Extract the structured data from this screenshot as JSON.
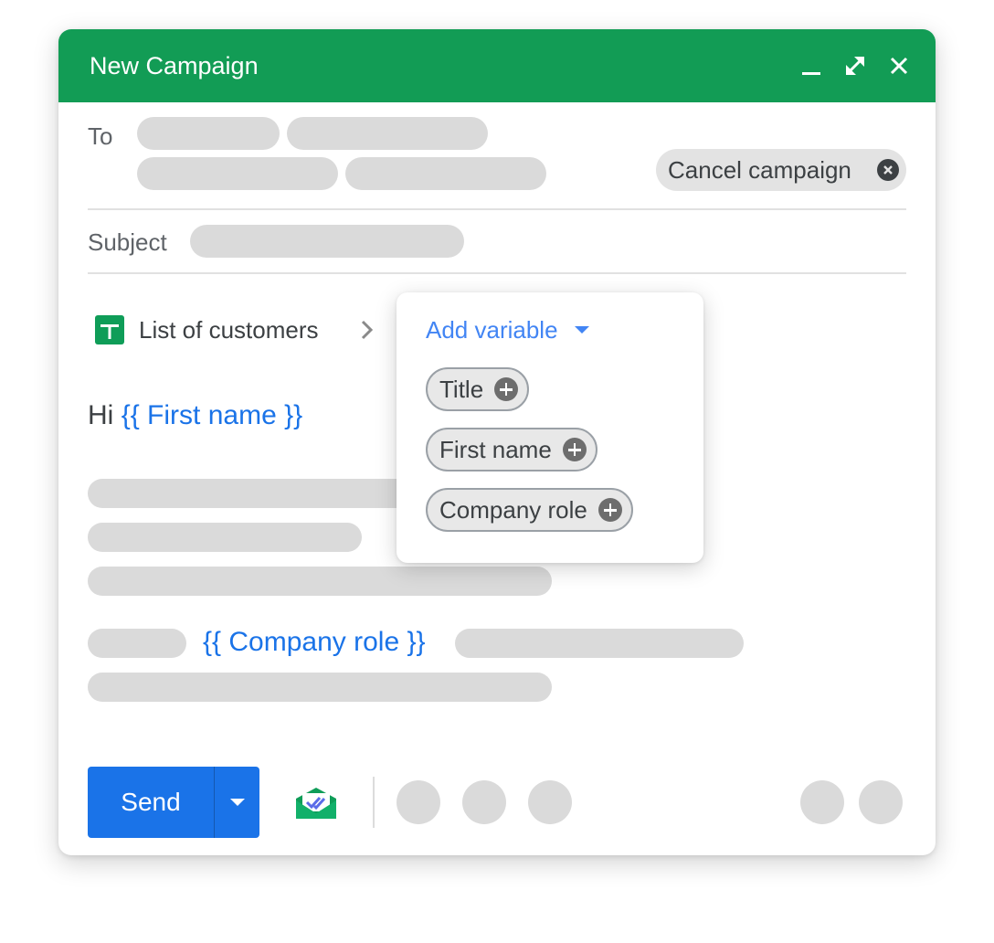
{
  "window": {
    "title": "New Campaign",
    "header_color": "#129c55",
    "controls": [
      "minimize-icon",
      "expand-icon",
      "close-icon"
    ]
  },
  "to": {
    "label": "To"
  },
  "cancel_chip": {
    "label": "Cancel campaign",
    "icon": "cancel-circle-icon"
  },
  "subject": {
    "label": "Subject"
  },
  "sheet": {
    "name": "List of customers",
    "icon": "google-sheets-icon",
    "chevron": "chevron-right-icon"
  },
  "body": {
    "greeting": "Hi",
    "first_name_var": "{{ First name }}",
    "company_role_var": "{{ Company role }}"
  },
  "popup": {
    "title": "Add variable",
    "variables": [
      "Title",
      "First name",
      "Company role"
    ]
  },
  "toolbar": {
    "send_label": "Send",
    "send_color": "#1a73e8",
    "more_send_icon": "caret-down-icon",
    "mailmerge_icon": "mail-merge-icon"
  }
}
